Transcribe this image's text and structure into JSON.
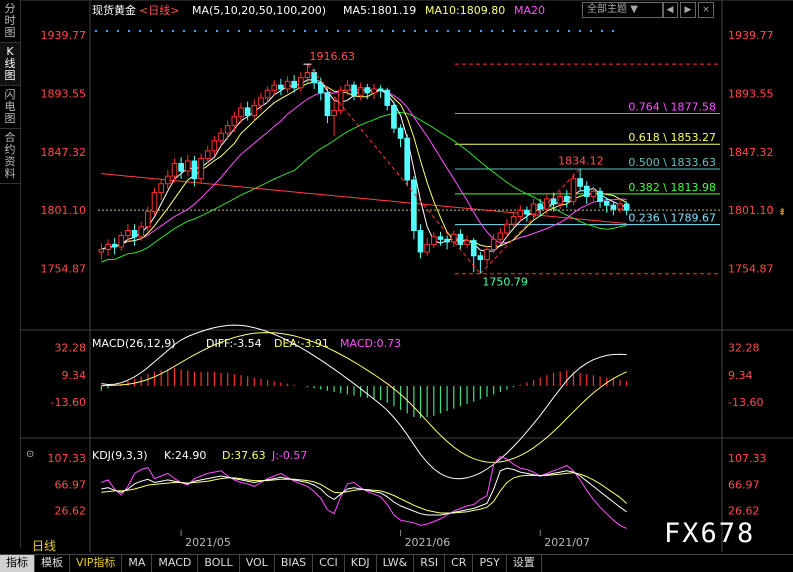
{
  "sidebar": {
    "items": [
      {
        "label": "分时图",
        "active": false
      },
      {
        "label": "K线图",
        "active": true
      },
      {
        "label": "闪电图",
        "active": false
      },
      {
        "label": "合约资料",
        "active": false
      }
    ]
  },
  "header": {
    "symbol": "现货黄金",
    "period_tag": "<日线>",
    "ma_label": "MA(5,10,20,50,100,200)",
    "ma5": "MA5:1801.19",
    "ma10": "MA10:1809.80",
    "ma20": "MA20",
    "theme_button": "全部主题",
    "theme_caret": "▼",
    "btn_prev": "◀",
    "btn_next": "▶",
    "btn_close": "×"
  },
  "colors": {
    "up": "#ff3030",
    "down": "#54ffff",
    "ma5": "#ffffff",
    "ma10": "#ffff70",
    "ma20": "#ff50ff",
    "ma50": "#30e030",
    "ma200": "#ff4040",
    "axis": "#ff4a4a",
    "fib_white": "#dddddd"
  },
  "chart_data": [
    {
      "type": "candlestick",
      "title": "现货黄金 日线",
      "y_ticks": [
        "1939.77",
        "1893.55",
        "1847.32",
        "1801.10",
        "1754.87"
      ],
      "ylim": [
        1730,
        1950
      ],
      "x_ticks": [
        "2021/05",
        "2021/06",
        "2021/07"
      ],
      "current_price": "1801.10",
      "annotations": {
        "high": "1916.63",
        "low": "1750.79",
        "swing_high": "1834.12"
      },
      "fib_levels": [
        {
          "ratio": "0.764",
          "price": "1877.58",
          "label": "0.764 \\ 1877.58",
          "value": 1877.58,
          "color": "#ff50ff"
        },
        {
          "ratio": "0.618",
          "price": "1853.27",
          "label": "0.618 \\ 1853.27",
          "value": 1853.27,
          "color": "#ffff60"
        },
        {
          "ratio": "0.500",
          "price": "1833.63",
          "label": "0.500 \\ 1833.63",
          "value": 1833.63,
          "color": "#60c0c0"
        },
        {
          "ratio": "0.382",
          "price": "1813.98",
          "label": "0.382 \\ 1813.98",
          "value": 1813.98,
          "color": "#40ff40"
        },
        {
          "ratio": "0.236",
          "price": "1789.67",
          "label": "0.236 \\ 1789.67",
          "value": 1789.67,
          "color": "#80e0ff"
        }
      ],
      "fib_top": 1916.63,
      "fib_bottom": 1750.79,
      "candles": [
        [
          1768,
          1770,
          1762,
          1775
        ],
        [
          1770,
          1774,
          1765,
          1778
        ],
        [
          1774,
          1772,
          1766,
          1779
        ],
        [
          1772,
          1781,
          1769,
          1784
        ],
        [
          1781,
          1785,
          1776,
          1790
        ],
        [
          1785,
          1780,
          1773,
          1790
        ],
        [
          1780,
          1788,
          1777,
          1792
        ],
        [
          1788,
          1800,
          1784,
          1804
        ],
        [
          1800,
          1815,
          1797,
          1819
        ],
        [
          1815,
          1822,
          1809,
          1826
        ],
        [
          1822,
          1828,
          1818,
          1833
        ],
        [
          1828,
          1838,
          1823,
          1842
        ],
        [
          1838,
          1832,
          1826,
          1843
        ],
        [
          1832,
          1840,
          1828,
          1845
        ],
        [
          1840,
          1826,
          1820,
          1844
        ],
        [
          1826,
          1842,
          1822,
          1846
        ],
        [
          1842,
          1848,
          1838,
          1852
        ],
        [
          1848,
          1856,
          1844,
          1860
        ],
        [
          1856,
          1862,
          1852,
          1866
        ],
        [
          1862,
          1868,
          1857,
          1872
        ],
        [
          1868,
          1875,
          1863,
          1879
        ],
        [
          1875,
          1882,
          1870,
          1886
        ],
        [
          1882,
          1876,
          1872,
          1887
        ],
        [
          1876,
          1884,
          1872,
          1889
        ],
        [
          1884,
          1890,
          1880,
          1894
        ],
        [
          1890,
          1896,
          1886,
          1899
        ],
        [
          1896,
          1900,
          1892,
          1904
        ],
        [
          1900,
          1897,
          1892,
          1905
        ],
        [
          1897,
          1903,
          1894,
          1907
        ],
        [
          1903,
          1898,
          1894,
          1908
        ],
        [
          1898,
          1906,
          1895,
          1910
        ],
        [
          1906,
          1910,
          1902,
          1916.63
        ],
        [
          1910,
          1902,
          1897,
          1913
        ],
        [
          1902,
          1894,
          1888,
          1906
        ],
        [
          1894,
          1876,
          1870,
          1898
        ],
        [
          1876,
          1880,
          1860,
          1890
        ],
        [
          1880,
          1896,
          1877,
          1899
        ],
        [
          1896,
          1900,
          1892,
          1904
        ],
        [
          1900,
          1892,
          1888,
          1903
        ],
        [
          1892,
          1898,
          1888,
          1902
        ],
        [
          1898,
          1894,
          1889,
          1901
        ],
        [
          1894,
          1897,
          1889,
          1901
        ],
        [
          1897,
          1896,
          1890,
          1900
        ],
        [
          1896,
          1884,
          1880,
          1898
        ],
        [
          1884,
          1866,
          1862,
          1887
        ],
        [
          1866,
          1858,
          1851,
          1869
        ],
        [
          1858,
          1825,
          1820,
          1861
        ],
        [
          1825,
          1785,
          1778,
          1828
        ],
        [
          1785,
          1768,
          1763,
          1790
        ],
        [
          1768,
          1774,
          1765,
          1779
        ],
        [
          1774,
          1780,
          1771,
          1784
        ],
        [
          1780,
          1778,
          1773,
          1784
        ],
        [
          1778,
          1776,
          1770,
          1781
        ],
        [
          1776,
          1782,
          1772,
          1785
        ],
        [
          1782,
          1774,
          1770,
          1786
        ],
        [
          1774,
          1777,
          1771,
          1781
        ],
        [
          1777,
          1765,
          1752,
          1779
        ],
        [
          1765,
          1762,
          1750.79,
          1768
        ],
        [
          1762,
          1770,
          1758,
          1773
        ],
        [
          1770,
          1778,
          1767,
          1782
        ],
        [
          1778,
          1783,
          1775,
          1787
        ],
        [
          1783,
          1790,
          1780,
          1794
        ],
        [
          1790,
          1796,
          1787,
          1800
        ],
        [
          1796,
          1801,
          1792,
          1805
        ],
        [
          1801,
          1798,
          1792,
          1804
        ],
        [
          1798,
          1806,
          1794,
          1810
        ],
        [
          1806,
          1802,
          1797,
          1810
        ],
        [
          1802,
          1810,
          1798,
          1814
        ],
        [
          1810,
          1806,
          1800,
          1815
        ],
        [
          1806,
          1812,
          1802,
          1816
        ],
        [
          1812,
          1808,
          1803,
          1817
        ],
        [
          1808,
          1826,
          1805,
          1830
        ],
        [
          1826,
          1820,
          1816,
          1834.12
        ],
        [
          1820,
          1812,
          1806,
          1824
        ],
        [
          1812,
          1816,
          1808,
          1820
        ],
        [
          1816,
          1808,
          1803,
          1819
        ],
        [
          1808,
          1805,
          1799,
          1811
        ],
        [
          1805,
          1802,
          1797,
          1808
        ],
        [
          1802,
          1806,
          1799,
          1810
        ],
        [
          1806,
          1801.1,
          1797,
          1808
        ]
      ],
      "ma200": [
        1830,
        1829.5,
        1829,
        1828.5,
        1828,
        1827.5,
        1827,
        1826.5,
        1826,
        1825.5,
        1825,
        1824.5,
        1824,
        1823.5,
        1823,
        1822.5,
        1822,
        1821.5,
        1821,
        1820.5,
        1820,
        1819.5,
        1819,
        1818.5,
        1818,
        1817.5,
        1817,
        1816.5,
        1816,
        1815.5,
        1815,
        1814.5,
        1814,
        1813.5,
        1813,
        1812.5,
        1812,
        1811.5,
        1811,
        1810.5,
        1810,
        1809.5,
        1809,
        1808.5,
        1808,
        1807.5,
        1807,
        1806.5,
        1806,
        1805.5,
        1805,
        1804.5,
        1804,
        1803.5,
        1803,
        1802.5,
        1802,
        1801.5,
        1801,
        1800.5,
        1800,
        1799.5,
        1799,
        1798.5,
        1798,
        1797.5,
        1797,
        1796.5,
        1796,
        1795.5,
        1795,
        1794.5,
        1794,
        1793.5,
        1793,
        1792.5,
        1792,
        1791.5,
        1791,
        1790.5
      ]
    },
    {
      "type": "bar",
      "title": "MACD(26,12,9)",
      "diff_label": "DIFF:-3.54",
      "dea_label": "DEA:-3.91",
      "macd_label": "MACD:0.73",
      "y_ticks": [
        "32.28",
        "9.34",
        "-13.60"
      ],
      "ylim": [
        -42,
        42
      ],
      "values": [
        -4,
        -2,
        0,
        2,
        4,
        6,
        8,
        10,
        12,
        13,
        14,
        15,
        14,
        13,
        12,
        12,
        12,
        12,
        11,
        11,
        10,
        9,
        8,
        7,
        6,
        5,
        4,
        3,
        2,
        1,
        0,
        -1,
        -2,
        -3,
        -4,
        -5,
        -6,
        -7,
        -8,
        -9,
        -10,
        -11,
        -12,
        -14,
        -17,
        -20,
        -23,
        -26,
        -27,
        -26,
        -25,
        -23,
        -21,
        -19,
        -17,
        -15,
        -13,
        -11,
        -9,
        -7,
        -5,
        -3,
        -1,
        1,
        3,
        5,
        7,
        9,
        11,
        12,
        13,
        12,
        11,
        10,
        9,
        8,
        7,
        6,
        5,
        4
      ]
    },
    {
      "type": "line",
      "title": "KDJ(9,3,3)",
      "k_label": "K:24.90",
      "d_label": "D:37.63",
      "j_label": "J:-0.57",
      "y_ticks": [
        "107.33",
        "66.97",
        "26.62"
      ],
      "ylim": [
        0,
        120
      ],
      "K": [
        60,
        62,
        58,
        55,
        60,
        68,
        72,
        75,
        70,
        72,
        74,
        72,
        70,
        68,
        72,
        74,
        76,
        78,
        80,
        78,
        76,
        74,
        72,
        70,
        72,
        74,
        76,
        78,
        76,
        74,
        72,
        70,
        66,
        60,
        50,
        44,
        52,
        60,
        62,
        60,
        58,
        56,
        54,
        48,
        40,
        34,
        30,
        26,
        22,
        20,
        20,
        20,
        22,
        24,
        26,
        28,
        30,
        34,
        38,
        60,
        88,
        92,
        90,
        86,
        84,
        82,
        80,
        82,
        84,
        86,
        88,
        86,
        80,
        72,
        64,
        56,
        48,
        40,
        32,
        24.9
      ],
      "D": [
        55,
        56,
        57,
        57,
        58,
        60,
        63,
        66,
        67,
        68,
        69,
        70,
        70,
        69,
        70,
        71,
        72,
        74,
        76,
        77,
        77,
        76,
        74,
        73,
        73,
        73,
        74,
        75,
        75,
        75,
        74,
        73,
        71,
        67,
        61,
        55,
        54,
        56,
        58,
        59,
        59,
        58,
        57,
        54,
        50,
        45,
        40,
        35,
        31,
        27,
        25,
        23,
        23,
        23,
        24,
        25,
        27,
        29,
        32,
        41,
        57,
        70,
        77,
        80,
        81,
        81,
        81,
        81,
        82,
        83,
        84,
        85,
        83,
        79,
        74,
        68,
        61,
        54,
        47,
        37.63
      ],
      "J": [
        70,
        74,
        60,
        51,
        64,
        84,
        90,
        93,
        76,
        80,
        84,
        76,
        70,
        66,
        76,
        80,
        84,
        86,
        88,
        80,
        74,
        70,
        68,
        64,
        70,
        76,
        80,
        84,
        78,
        72,
        68,
        64,
        56,
        46,
        28,
        22,
        48,
        68,
        70,
        62,
        56,
        52,
        48,
        36,
        20,
        12,
        10,
        8,
        4,
        6,
        10,
        14,
        20,
        26,
        30,
        34,
        36,
        44,
        50,
        98,
        110,
        106,
        98,
        92,
        90,
        86,
        80,
        84,
        88,
        92,
        96,
        88,
        74,
        58,
        44,
        32,
        22,
        12,
        4,
        -0.57
      ]
    }
  ],
  "period_label": "日线",
  "bottom_tabs": [
    {
      "label": "指标",
      "active": true
    },
    {
      "label": "模板",
      "active": false
    },
    {
      "label": "VIP指标",
      "active": false,
      "vip": true
    },
    {
      "label": "MA",
      "active": false
    },
    {
      "label": "MACD",
      "active": false
    },
    {
      "label": "BOLL",
      "active": false
    },
    {
      "label": "VOL",
      "active": false
    },
    {
      "label": "BIAS",
      "active": false
    },
    {
      "label": "CCI",
      "active": false
    },
    {
      "label": "KDJ",
      "active": false
    },
    {
      "label": "LW&",
      "active": false
    },
    {
      "label": "RSI",
      "active": false
    },
    {
      "label": "CR",
      "active": false
    },
    {
      "label": "PSY",
      "active": false
    },
    {
      "label": "设置",
      "active": false
    }
  ],
  "watermark": "FX678"
}
